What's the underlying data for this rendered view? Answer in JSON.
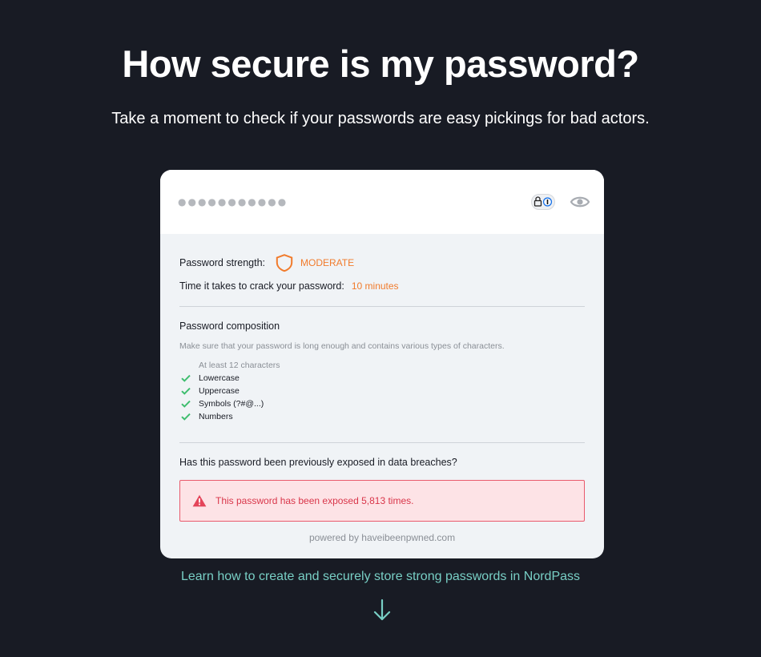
{
  "header": {
    "title": "How secure is my password?",
    "subtitle": "Take a moment to check if your passwords are easy pickings for bad actors."
  },
  "password_field": {
    "masked_value": "●●●●●●●●●●●",
    "extension_icon": "1password-icon",
    "toggle_icon": "eye-icon"
  },
  "strength": {
    "label": "Password strength:",
    "value": "MODERATE",
    "icon": "shield-icon",
    "color": "#f17b2c"
  },
  "crack_time": {
    "label": "Time it takes to crack your password:",
    "value": "10 minutes"
  },
  "composition": {
    "title": "Password composition",
    "description": "Make sure that your password is long enough and contains various types of characters.",
    "criteria": [
      {
        "label": "At least 12 characters",
        "met": false
      },
      {
        "label": "Lowercase",
        "met": true
      },
      {
        "label": "Uppercase",
        "met": true
      },
      {
        "label": "Symbols (?#@...)",
        "met": true
      },
      {
        "label": "Numbers",
        "met": true
      }
    ],
    "check_color": "#3ebd6e"
  },
  "breach": {
    "question": "Has this password been previously exposed in data breaches?",
    "alert_text": "This password has been exposed 5,813 times.",
    "alert_icon": "warning-icon",
    "alert_color": "#d9364a",
    "powered_by": "powered by haveibeenpwned.com"
  },
  "footer": {
    "learn_link": "Learn how to create and securely store strong passwords in NordPass",
    "arrow_icon": "arrow-down-icon",
    "accent": "#78cfc5"
  }
}
